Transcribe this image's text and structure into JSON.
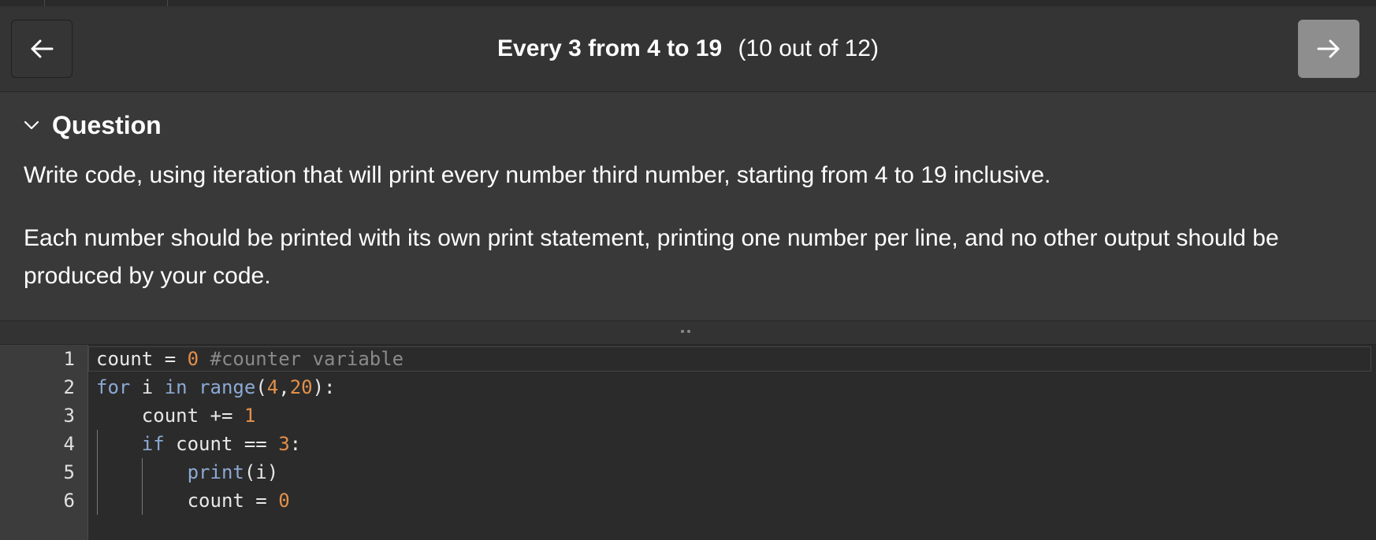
{
  "header": {
    "title": "Every 3 from 4 to 19",
    "progress": "(10 out of 12)",
    "prev_icon": "arrow-left-icon",
    "next_icon": "arrow-right-icon"
  },
  "question": {
    "toggle_icon": "chevron-down-icon",
    "heading": "Question",
    "paragraphs": [
      "Write code, using iteration that will print every number third number, starting from 4 to 19 inclusive.",
      "Each number should be printed with its own print statement, printing one number per line, and no other output should be produced by your code."
    ]
  },
  "splitter": {
    "icon": "drag-handle-icon"
  },
  "editor": {
    "line_numbers": [
      "1",
      "2",
      "3",
      "4",
      "5",
      "6"
    ],
    "lines": [
      [
        {
          "t": "count = ",
          "c": "plain"
        },
        {
          "t": "0",
          "c": "num"
        },
        {
          "t": " #counter variable",
          "c": "cmt"
        }
      ],
      [
        {
          "t": "for",
          "c": "kw"
        },
        {
          "t": " i ",
          "c": "plain"
        },
        {
          "t": "in",
          "c": "kw"
        },
        {
          "t": " ",
          "c": "plain"
        },
        {
          "t": "range",
          "c": "kw"
        },
        {
          "t": "(",
          "c": "plain"
        },
        {
          "t": "4",
          "c": "num"
        },
        {
          "t": ",",
          "c": "plain"
        },
        {
          "t": "20",
          "c": "num"
        },
        {
          "t": "):",
          "c": "plain"
        }
      ],
      [
        {
          "t": "    count += ",
          "c": "plain"
        },
        {
          "t": "1",
          "c": "num"
        }
      ],
      [
        {
          "t": "    ",
          "c": "plain"
        },
        {
          "t": "if",
          "c": "kw"
        },
        {
          "t": " count == ",
          "c": "plain"
        },
        {
          "t": "3",
          "c": "num"
        },
        {
          "t": ":",
          "c": "plain"
        }
      ],
      [
        {
          "t": "        ",
          "c": "plain"
        },
        {
          "t": "print",
          "c": "kw"
        },
        {
          "t": "(i)",
          "c": "plain"
        }
      ],
      [
        {
          "t": "        count = ",
          "c": "plain"
        },
        {
          "t": "0",
          "c": "num"
        }
      ]
    ]
  },
  "colors": {
    "background": "#333333",
    "keyword": "#8ca9d4",
    "number": "#e3904a",
    "comment": "#8a8a8a",
    "next_button": "#8e8e8e"
  }
}
